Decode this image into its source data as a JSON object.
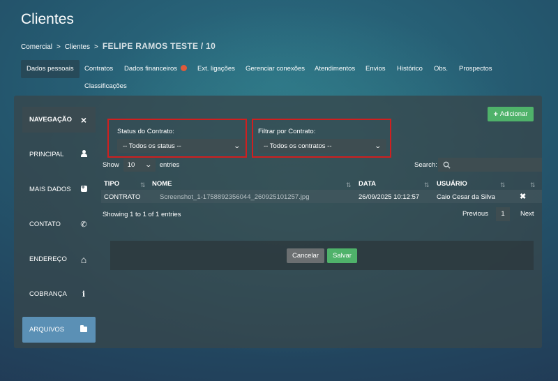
{
  "page": {
    "title": "Clientes"
  },
  "breadcrumb": {
    "items": [
      "Comercial",
      "Clientes"
    ],
    "sep": ">",
    "current": "FELIPE RAMOS TESTE / 10"
  },
  "tabs": [
    {
      "label": "Dados pessoais",
      "active": true
    },
    {
      "label": "Contratos"
    },
    {
      "label": "Dados financeiros",
      "badge": true
    },
    {
      "label": "Ext. ligações"
    },
    {
      "label": "Gerenciar conexões"
    },
    {
      "label": "Atendimentos"
    },
    {
      "label": "Envios"
    },
    {
      "label": "Histórico"
    },
    {
      "label": "Obs."
    },
    {
      "label": "Prospectos"
    },
    {
      "label": "Classificações"
    }
  ],
  "sidebar": {
    "header": "NAVEGAÇÃO",
    "close_icon": "×",
    "items": [
      {
        "label": "PRINCIPAL",
        "icon": "user-icon"
      },
      {
        "label": "MAIS DADOS",
        "icon": "plus-square-icon"
      },
      {
        "label": "CONTATO",
        "icon": "phone-icon",
        "glyph": "✆"
      },
      {
        "label": "ENDEREÇO",
        "icon": "home-icon",
        "glyph": "⌂"
      },
      {
        "label": "COBRANÇA",
        "icon": "info-icon",
        "glyph": "i"
      },
      {
        "label": "ARQUIVOS",
        "icon": "folder-icon",
        "active": true
      }
    ]
  },
  "toolbar": {
    "add_label": "Adicionar",
    "add_glyph": "+"
  },
  "filters": {
    "status": {
      "label": "Status do Contrato:",
      "value": "-- Todos os status --"
    },
    "contract": {
      "label": "Filtrar por Contrato:",
      "value": "-- Todos os contratos --"
    }
  },
  "table_controls": {
    "show": "Show",
    "length": "10",
    "entries": "entries",
    "search": "Search:"
  },
  "table": {
    "columns": [
      "TIPO",
      "NOME",
      "DATA",
      "USUÁRIO"
    ],
    "rows": [
      {
        "tipo": "CONTRATO",
        "nome": "Screenshot_1-1758892356044_260925101257.jpg",
        "data": "26/09/2025 10:12:57",
        "usuario": "Caio Cesar da Silva",
        "action": "✖"
      }
    ]
  },
  "pagination": {
    "info": "Showing 1 to 1 of 1 entries",
    "previous": "Previous",
    "page": "1",
    "next": "Next"
  },
  "form_actions": {
    "cancel": "Cancelar",
    "save": "Salvar"
  },
  "colors": {
    "accent_green": "#4fb26a",
    "active_nav": "#5b90b5",
    "highlight_border": "#d01f1f",
    "badge": "#e05a3a"
  }
}
